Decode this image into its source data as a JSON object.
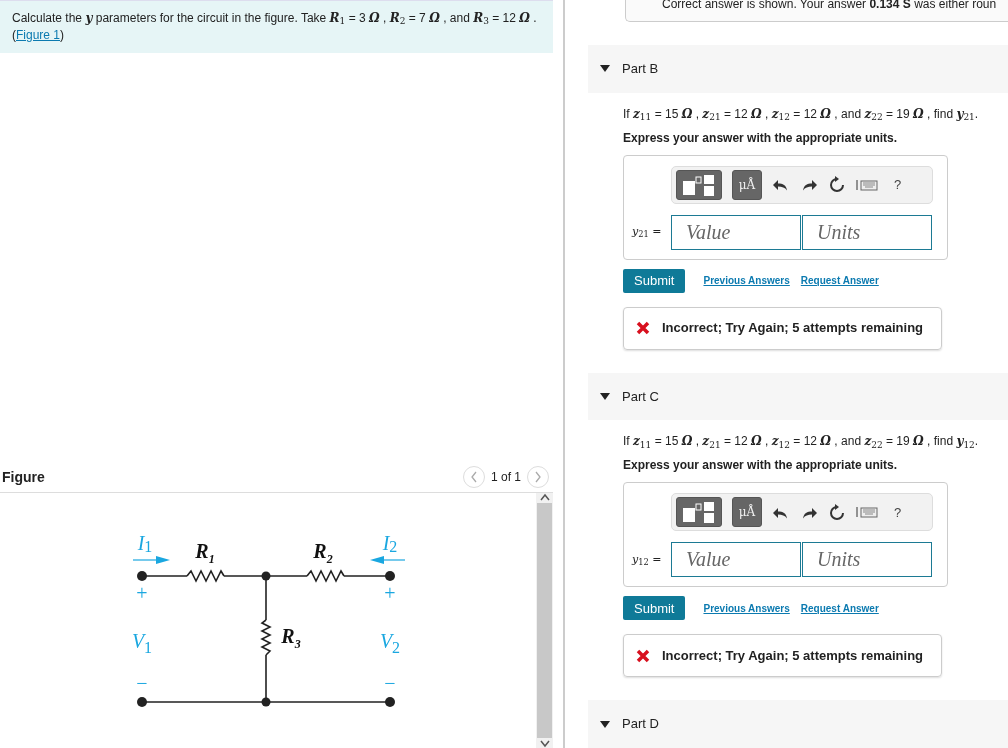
{
  "problem": {
    "text": "Calculate the *y* parameters for the circuit in the figure. Take **R**$_{1}$ = 3 **Ω** , **R**$_{2}$ = 7 **Ω** , and **R**$_{3}$ = 12 **Ω** . (",
    "link": "Figure 1",
    "text_after": ")"
  },
  "figure": {
    "title": "Figure",
    "pager": "1 of 1",
    "labels": [
      {
        "kind": "current",
        "text": "I",
        "sub": "1"
      },
      {
        "kind": "resistor",
        "text": "R",
        "sub": "1"
      },
      {
        "kind": "resistor",
        "text": "R",
        "sub": "2"
      },
      {
        "kind": "current",
        "text": "I",
        "sub": "2"
      },
      {
        "kind": "sign",
        "text": "+"
      },
      {
        "kind": "sign",
        "text": "+"
      },
      {
        "kind": "voltage",
        "text": "V",
        "sub": "1"
      },
      {
        "kind": "resistor",
        "text": "R",
        "sub": "3"
      },
      {
        "kind": "voltage",
        "text": "V",
        "sub": "2"
      },
      {
        "kind": "sign",
        "text": "−"
      },
      {
        "kind": "sign",
        "text": "−"
      }
    ]
  },
  "top_feedback": {
    "text": "Correct answer is shown. Your answer **0.134 S** was either roun"
  },
  "parts": [
    {
      "title": "Part B",
      "expanded": true,
      "question": "If *z*$_{11}$ = 15 **Ω** , *z*$_{21}$ = 12 **Ω** , *z*$_{12}$ = 12 **Ω** , and *z*$_{22}$ = 19 **Ω** , find *y*$_{21}$.",
      "instruction": "Express your answer with the appropriate units.",
      "units_button": "μÅ",
      "help": "?",
      "answer_label": "*y*$_{21}$ =",
      "value_placeholder": "Value",
      "units_placeholder": "Units",
      "submit": "Submit",
      "links": [
        "Previous Answers",
        "Request Answer"
      ],
      "feedback": {
        "kind": "incorrect",
        "text": "Incorrect; Try Again; 5 attempts remaining"
      }
    },
    {
      "title": "Part C",
      "expanded": true,
      "question": "If *z*$_{11}$ = 15 **Ω** , *z*$_{21}$ = 12 **Ω** , *z*$_{12}$ = 12 **Ω** , and *z*$_{22}$ = 19 **Ω** , find *y*$_{12}$.",
      "instruction": "Express your answer with the appropriate units.",
      "units_button": "μÅ",
      "help": "?",
      "answer_label": "*y*$_{12}$ =",
      "value_placeholder": "Value",
      "units_placeholder": "Units",
      "submit": "Submit",
      "links": [
        "Previous Answers",
        "Request Answer"
      ],
      "feedback": {
        "kind": "incorrect",
        "text": "Incorrect; Try Again; 5 attempts remaining"
      }
    },
    {
      "title": "Part D",
      "expanded": true
    }
  ]
}
